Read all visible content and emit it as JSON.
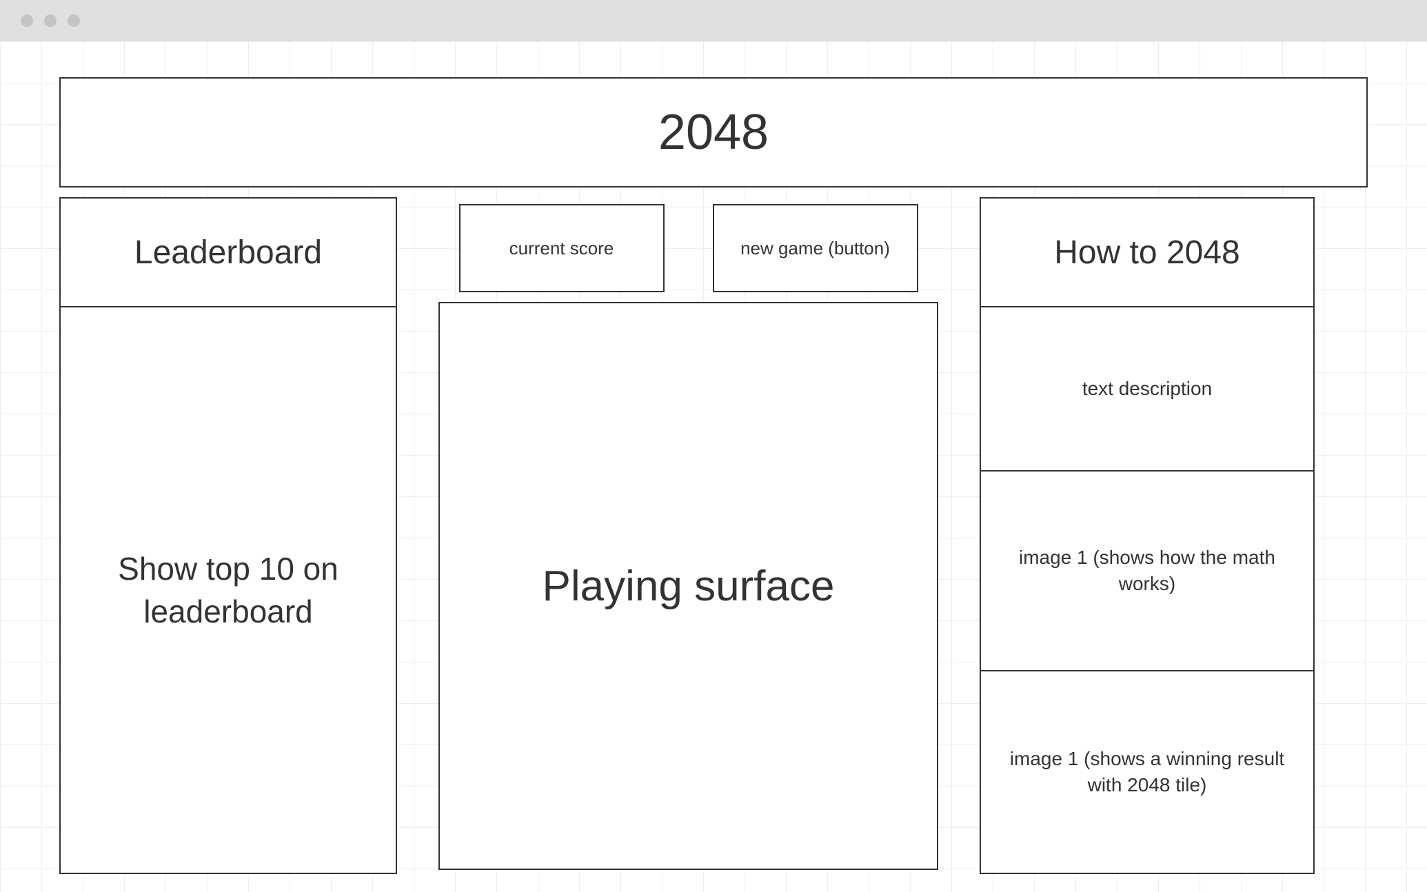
{
  "header": {
    "title": "2048"
  },
  "leaderboard": {
    "heading": "Leaderboard",
    "body": "Show top 10 on leaderboard"
  },
  "center": {
    "score_label": "current score",
    "new_game_label": "new game (button)",
    "surface_label": "Playing surface"
  },
  "howto": {
    "heading": "How to 2048",
    "cells": {
      "c1": "text description",
      "c2": "image 1 (shows how the math works)",
      "c3": "image 1 (shows a winning result with 2048 tile)"
    }
  }
}
